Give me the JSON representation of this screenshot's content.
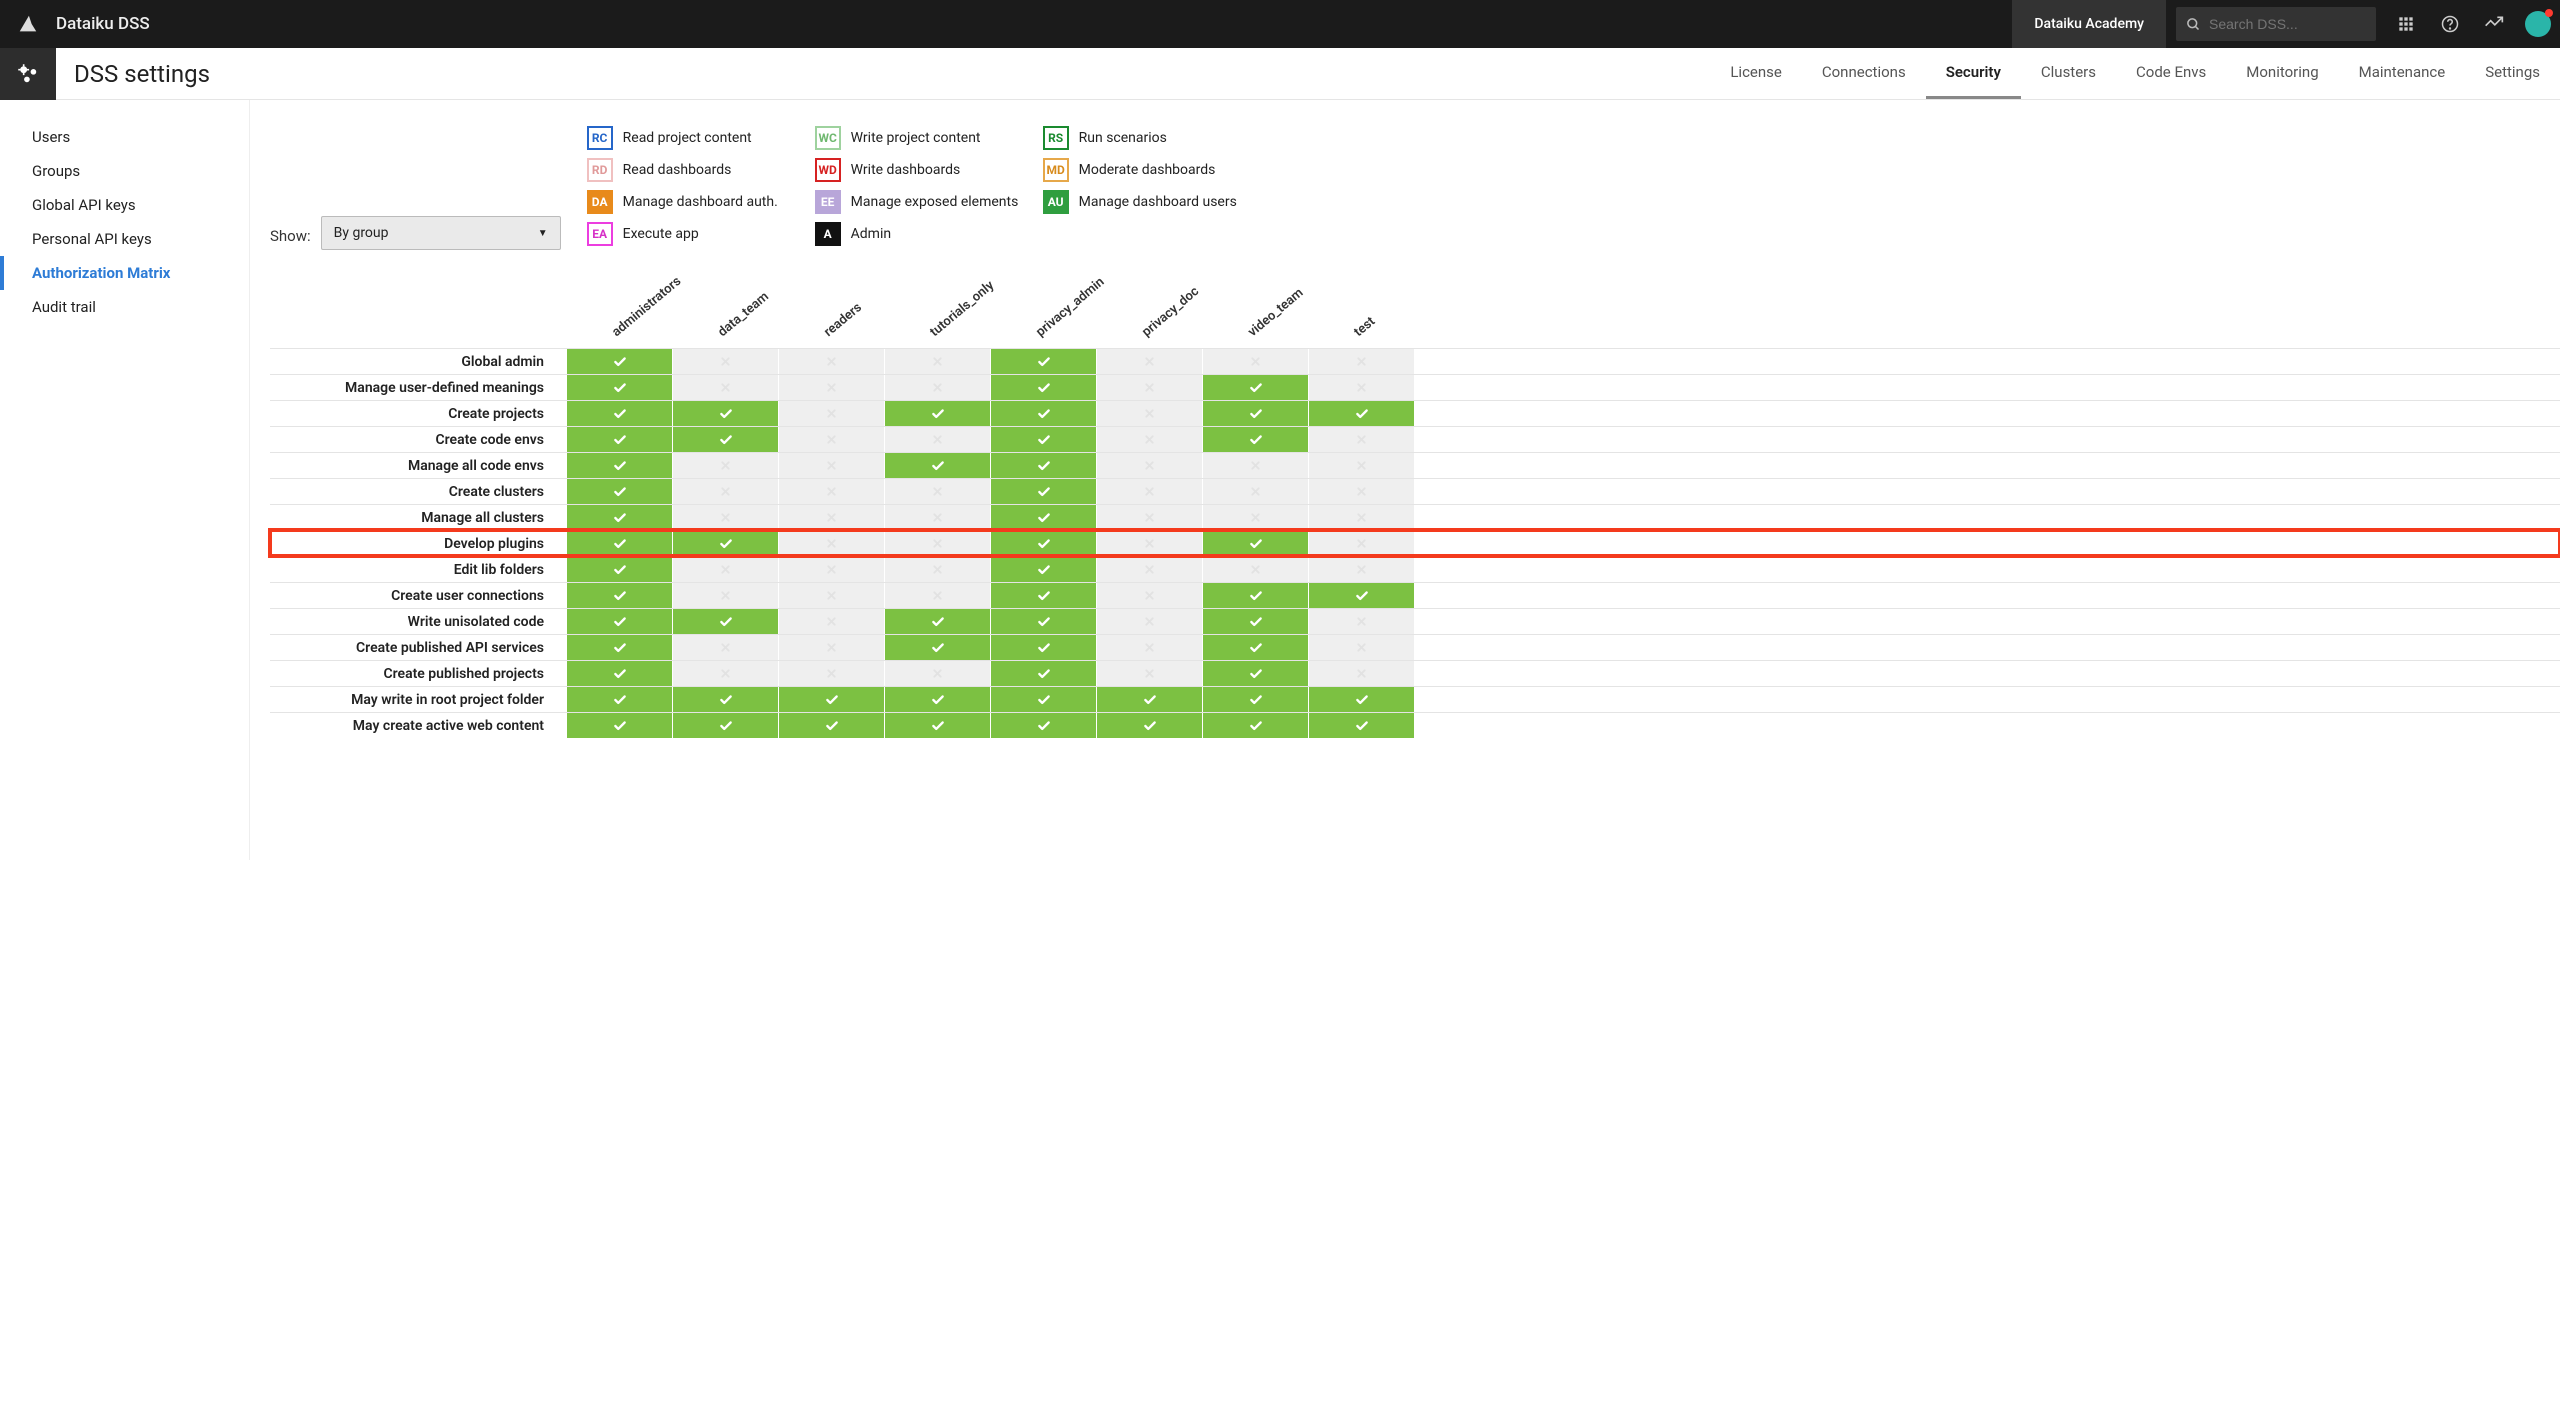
{
  "topbar": {
    "brand": "Dataiku DSS",
    "academy": "Dataiku Academy",
    "search_placeholder": "Search DSS..."
  },
  "settings_header": {
    "title": "DSS settings",
    "tabs": [
      "License",
      "Connections",
      "Security",
      "Clusters",
      "Code Envs",
      "Monitoring",
      "Maintenance",
      "Settings"
    ],
    "active_tab": "Security"
  },
  "sidebar": {
    "items": [
      "Users",
      "Groups",
      "Global API keys",
      "Personal API keys",
      "Authorization Matrix",
      "Audit trail"
    ],
    "active": "Authorization Matrix"
  },
  "show": {
    "label": "Show:",
    "value": "By group"
  },
  "legend": [
    {
      "code": "RC",
      "text": "Read project content",
      "cls": "cb-RC"
    },
    {
      "code": "WC",
      "text": "Write project content",
      "cls": "cb-WC"
    },
    {
      "code": "RS",
      "text": "Run scenarios",
      "cls": "cb-RS"
    },
    {
      "code": "RD",
      "text": "Read dashboards",
      "cls": "cb-RD"
    },
    {
      "code": "WD",
      "text": "Write dashboards",
      "cls": "cb-WD"
    },
    {
      "code": "MD",
      "text": "Moderate dashboards",
      "cls": "cb-MD"
    },
    {
      "code": "DA",
      "text": "Manage dashboard auth.",
      "cls": "cb-DA"
    },
    {
      "code": "EE",
      "text": "Manage exposed elements",
      "cls": "cb-EE"
    },
    {
      "code": "AU",
      "text": "Manage dashboard users",
      "cls": "cb-AU"
    },
    {
      "code": "EA",
      "text": "Execute app",
      "cls": "cb-EA"
    },
    {
      "code": "A",
      "text": "Admin",
      "cls": "cb-A"
    }
  ],
  "matrix": {
    "columns": [
      "administrators",
      "data_team",
      "readers",
      "tutorials_only",
      "privacy_admin",
      "privacy_doc",
      "video_team",
      "test"
    ],
    "highlight_row": "Develop plugins",
    "rows": [
      {
        "label": "Global admin",
        "cells": [
          1,
          0,
          0,
          0,
          1,
          0,
          0,
          0
        ]
      },
      {
        "label": "Manage user-defined meanings",
        "cells": [
          1,
          0,
          0,
          0,
          1,
          0,
          1,
          0
        ]
      },
      {
        "label": "Create projects",
        "cells": [
          1,
          1,
          0,
          1,
          1,
          0,
          1,
          1
        ]
      },
      {
        "label": "Create code envs",
        "cells": [
          1,
          1,
          0,
          0,
          1,
          0,
          1,
          0
        ]
      },
      {
        "label": "Manage all code envs",
        "cells": [
          1,
          0,
          0,
          1,
          1,
          0,
          0,
          0
        ]
      },
      {
        "label": "Create clusters",
        "cells": [
          1,
          0,
          0,
          0,
          1,
          0,
          0,
          0
        ]
      },
      {
        "label": "Manage all clusters",
        "cells": [
          1,
          0,
          0,
          0,
          1,
          0,
          0,
          0
        ]
      },
      {
        "label": "Develop plugins",
        "cells": [
          1,
          1,
          0,
          0,
          1,
          0,
          1,
          0
        ]
      },
      {
        "label": "Edit lib folders",
        "cells": [
          1,
          0,
          0,
          0,
          1,
          0,
          0,
          0
        ]
      },
      {
        "label": "Create user connections",
        "cells": [
          1,
          0,
          0,
          0,
          1,
          0,
          1,
          1
        ]
      },
      {
        "label": "Write unisolated code",
        "cells": [
          1,
          1,
          0,
          1,
          1,
          0,
          1,
          0
        ]
      },
      {
        "label": "Create published API services",
        "cells": [
          1,
          0,
          0,
          1,
          1,
          0,
          1,
          0
        ]
      },
      {
        "label": "Create published projects",
        "cells": [
          1,
          0,
          0,
          0,
          1,
          0,
          1,
          0
        ]
      },
      {
        "label": "May write in root project folder",
        "cells": [
          1,
          1,
          1,
          1,
          1,
          1,
          1,
          1
        ]
      },
      {
        "label": "May create active web content",
        "cells": [
          1,
          1,
          1,
          1,
          1,
          1,
          1,
          1
        ]
      }
    ]
  }
}
